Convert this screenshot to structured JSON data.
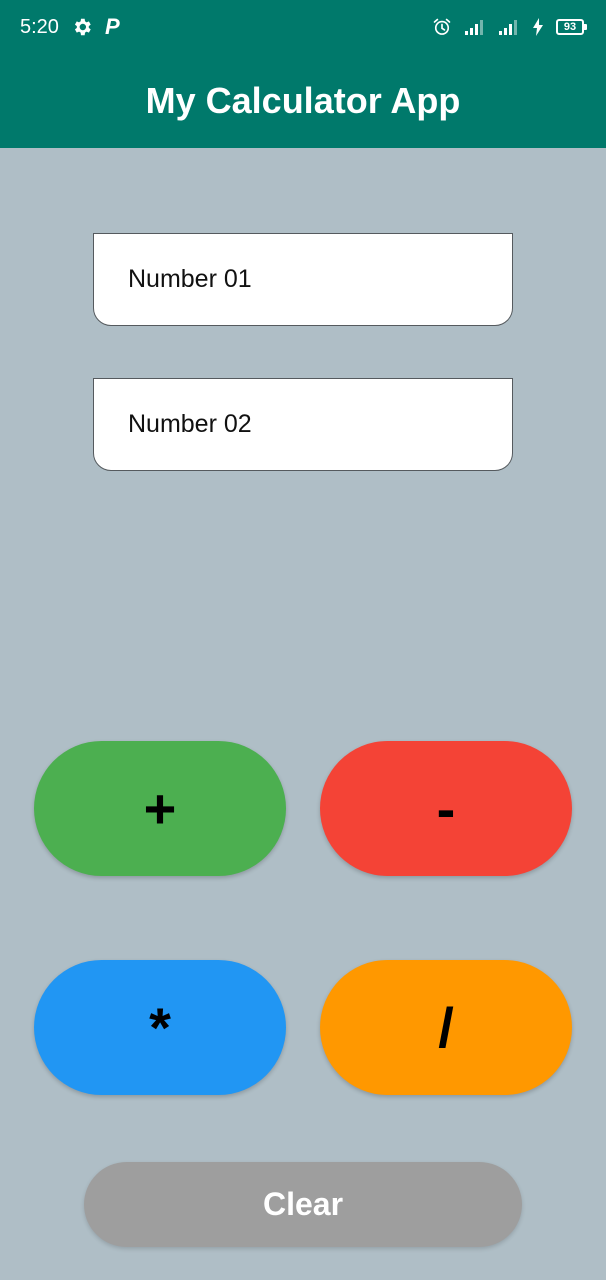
{
  "status_bar": {
    "time": "5:20",
    "left_icons": [
      "gear-icon",
      "p-icon"
    ],
    "p_glyph": "P",
    "right_icons": [
      "alarm-icon",
      "signal-icon",
      "signal-icon",
      "charging-icon",
      "battery-icon"
    ],
    "battery_level": "93"
  },
  "app_bar": {
    "title": "My Calculator App",
    "color": "#00796b"
  },
  "inputs": {
    "number1": {
      "placeholder": "Number 01",
      "value": ""
    },
    "number2": {
      "placeholder": "Number 02",
      "value": ""
    }
  },
  "operations": {
    "add": {
      "label": "+",
      "color": "#4caf50"
    },
    "subtract": {
      "label": "-",
      "color": "#f44336"
    },
    "multiply": {
      "label": "*",
      "color": "#2196f3"
    },
    "divide": {
      "label": "/",
      "color": "#ff9800"
    }
  },
  "clear": {
    "label": "Clear",
    "color": "#9e9e9e"
  },
  "background": "#afbec6"
}
